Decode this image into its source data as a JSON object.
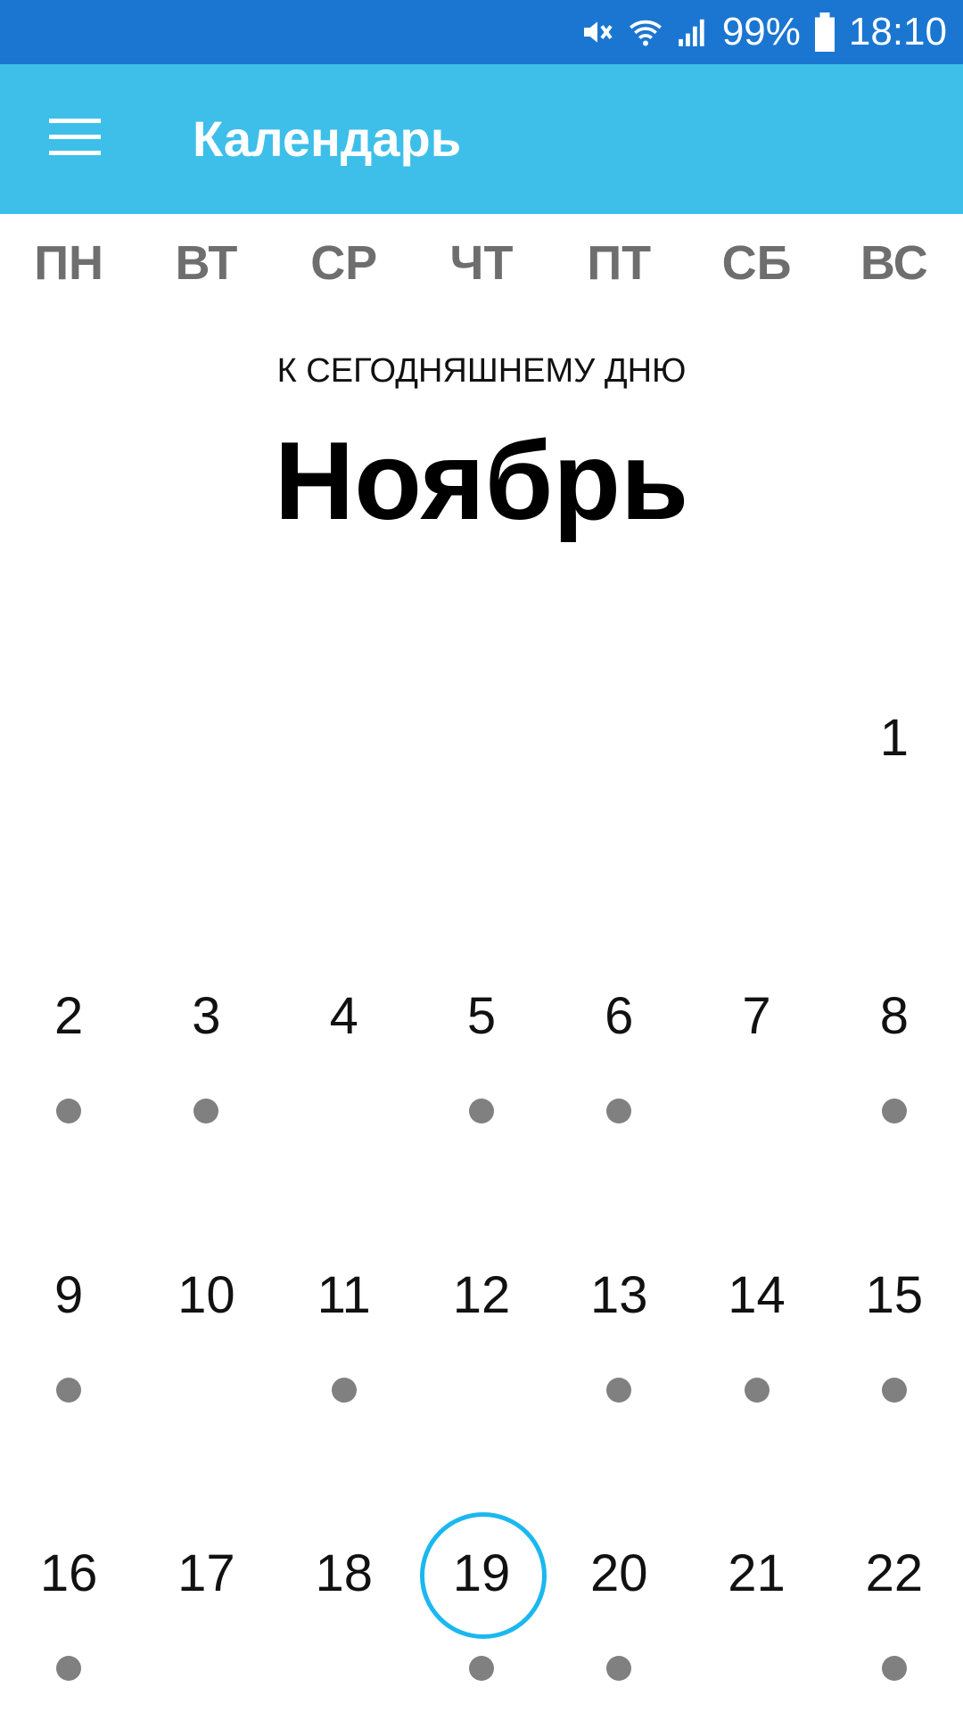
{
  "status_bar": {
    "battery": "99%",
    "time": "18:10",
    "icons": [
      "mute-icon",
      "wifi-icon",
      "signal-icon",
      "battery-icon"
    ]
  },
  "app_bar": {
    "title": "Календарь",
    "menu_icon": "hamburger-menu-icon",
    "background": "#3dbfea"
  },
  "weekdays": [
    "ПН",
    "ВТ",
    "СР",
    "ЧТ",
    "ПТ",
    "СБ",
    "ВС"
  ],
  "today_link": "К СЕГОДНЯШНЕМУ ДНЮ",
  "month": "Ноябрь",
  "calendar": {
    "today": 19,
    "accent": "#1bb8ef",
    "weeks": [
      [
        {
          "day": "",
          "dot": false
        },
        {
          "day": "",
          "dot": false
        },
        {
          "day": "",
          "dot": false
        },
        {
          "day": "",
          "dot": false
        },
        {
          "day": "",
          "dot": false
        },
        {
          "day": "",
          "dot": false
        },
        {
          "day": "1",
          "dot": false
        }
      ],
      [
        {
          "day": "2",
          "dot": true
        },
        {
          "day": "3",
          "dot": true
        },
        {
          "day": "4",
          "dot": false
        },
        {
          "day": "5",
          "dot": true
        },
        {
          "day": "6",
          "dot": true
        },
        {
          "day": "7",
          "dot": false
        },
        {
          "day": "8",
          "dot": true
        }
      ],
      [
        {
          "day": "9",
          "dot": true
        },
        {
          "day": "10",
          "dot": false
        },
        {
          "day": "11",
          "dot": true
        },
        {
          "day": "12",
          "dot": false
        },
        {
          "day": "13",
          "dot": true
        },
        {
          "day": "14",
          "dot": true
        },
        {
          "day": "15",
          "dot": true
        }
      ],
      [
        {
          "day": "16",
          "dot": true
        },
        {
          "day": "17",
          "dot": false
        },
        {
          "day": "18",
          "dot": false
        },
        {
          "day": "19",
          "dot": true
        },
        {
          "day": "20",
          "dot": true
        },
        {
          "day": "21",
          "dot": false
        },
        {
          "day": "22",
          "dot": true
        }
      ]
    ]
  }
}
